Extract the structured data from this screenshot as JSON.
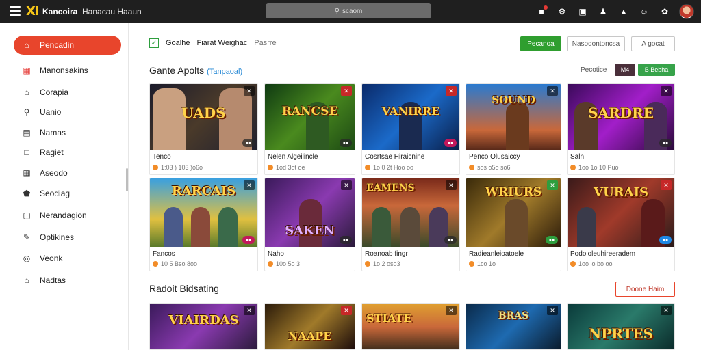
{
  "header": {
    "logo_mark": "XI",
    "logo_text": "Kancoira",
    "logo_sub": "Hanacau Haaun",
    "search_placeholder": "scaom",
    "icons": [
      "notification-icon",
      "gear-icon",
      "window-icon",
      "user-icon",
      "warning-icon",
      "face-icon",
      "settings-icon"
    ]
  },
  "sidebar": {
    "active": {
      "label": "Pencadin",
      "icon": "home-icon"
    },
    "items": [
      {
        "label": "Manonsakins",
        "icon": "calendar-icon"
      },
      {
        "label": "Corapia",
        "icon": "home-outline-icon"
      },
      {
        "label": "Uanio",
        "icon": "search-icon"
      },
      {
        "label": "Namas",
        "icon": "list-icon"
      },
      {
        "label": "Ragiet",
        "icon": "box-icon"
      },
      {
        "label": "Aseodo",
        "icon": "grid-icon"
      },
      {
        "label": "Seodiag",
        "icon": "shield-icon"
      },
      {
        "label": "Nerandagion",
        "icon": "folder-icon"
      },
      {
        "label": "Optikines",
        "icon": "pencil-icon"
      },
      {
        "label": "Veonk",
        "icon": "target-icon"
      },
      {
        "label": "Nadtas",
        "icon": "house-icon"
      }
    ]
  },
  "filterbar": {
    "items": [
      "Goalhe",
      "Fiarat Weighac",
      "Pasrre"
    ],
    "primary_button": "Pecanoa",
    "secondary_button": "Nasodontoncsa",
    "third_button": "A gocat"
  },
  "section1": {
    "title": "Gante Apolts",
    "tag": "(Tanpaoal)",
    "sort_label": "Pecotice",
    "mini_dark": "M4",
    "mini_green": "B Bebha"
  },
  "section2": {
    "title": "Radoit Bidsating",
    "button": "Doone Haim"
  },
  "row1": [
    {
      "art": "UADS",
      "name": "Tenco",
      "meta": "1:03 ) 103 )o6o"
    },
    {
      "art": "RANCSE",
      "name": "Nelen Algeilincle",
      "meta": "1od 3ot oe"
    },
    {
      "art": "VANIRRE",
      "name": "Cosrtsae Hiraicnine",
      "meta": "1o 0 2t Hoo oo"
    },
    {
      "art": "SOUND",
      "name": "Penco Olusaiccy",
      "meta": "sos o5o so6"
    },
    {
      "art": "SARDRE",
      "name": "Saln",
      "meta": "1oo 1o 10 Puo"
    }
  ],
  "row2": [
    {
      "art": "RARCAIS",
      "name": "Fancos",
      "meta": "10 5 Bso 8oo"
    },
    {
      "art": "SAKEN",
      "name": "Naho",
      "meta": "10o 5o 3"
    },
    {
      "art": "EAMENS",
      "name": "Roanoab fingr",
      "meta": "1o 2 oso3"
    },
    {
      "art": "WRIURS",
      "name": "Radieanleioatoele",
      "meta": "1co 1o"
    },
    {
      "art": "VURAIS",
      "name": "Podoioleuhireeradem",
      "meta": "1oo io bo oo"
    }
  ],
  "row3": [
    {
      "art": "VIAIRDAS"
    },
    {
      "art": "NAAPE"
    },
    {
      "art": "STIATE"
    },
    {
      "art": "BRAS"
    },
    {
      "art": "NPRTES"
    }
  ]
}
